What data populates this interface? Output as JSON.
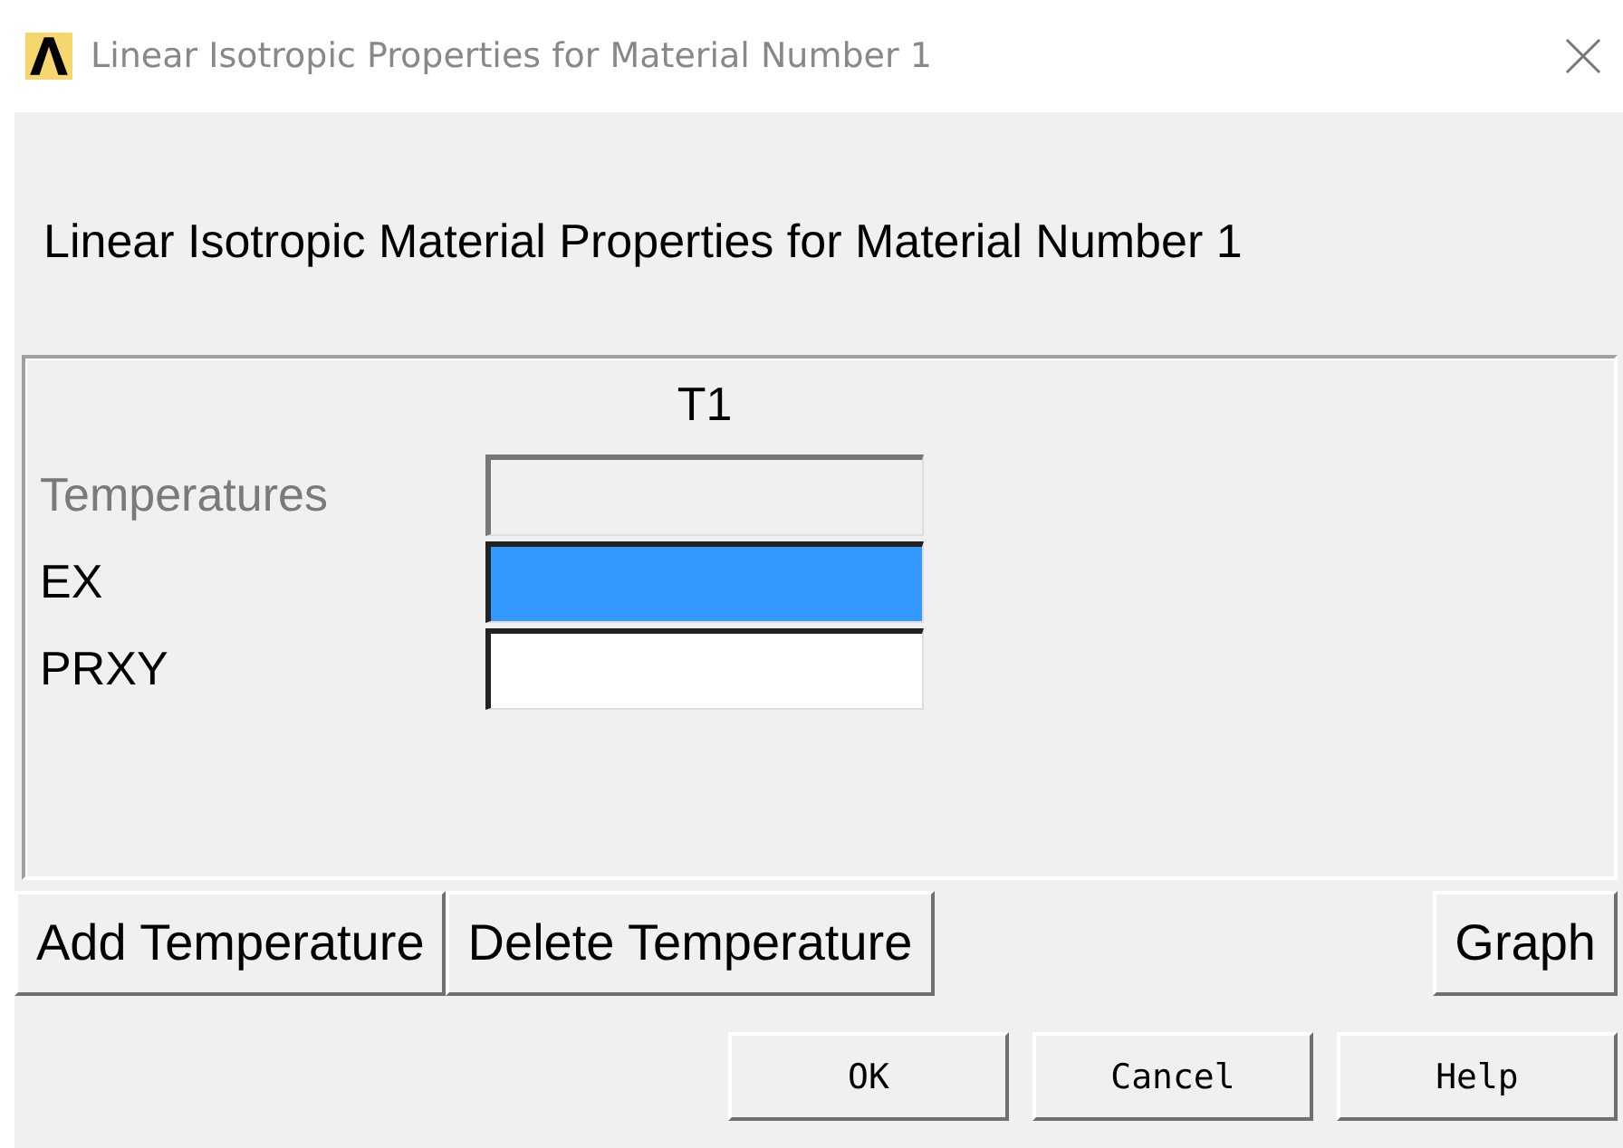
{
  "window": {
    "title": "Linear Isotropic Properties for Material Number 1"
  },
  "heading": "Linear Isotropic Material Properties for Material Number 1",
  "table": {
    "columns": [
      "T1"
    ],
    "rows": [
      {
        "label": "Temperatures",
        "disabled": true,
        "selected": false
      },
      {
        "label": "EX",
        "disabled": false,
        "selected": true
      },
      {
        "label": "PRXY",
        "disabled": false,
        "selected": false
      }
    ]
  },
  "table_buttons": [
    "Add Temperature",
    "Delete Temperature"
  ],
  "graph_button": "Graph",
  "buttons": [
    "OK",
    "Cancel",
    "Help"
  ]
}
